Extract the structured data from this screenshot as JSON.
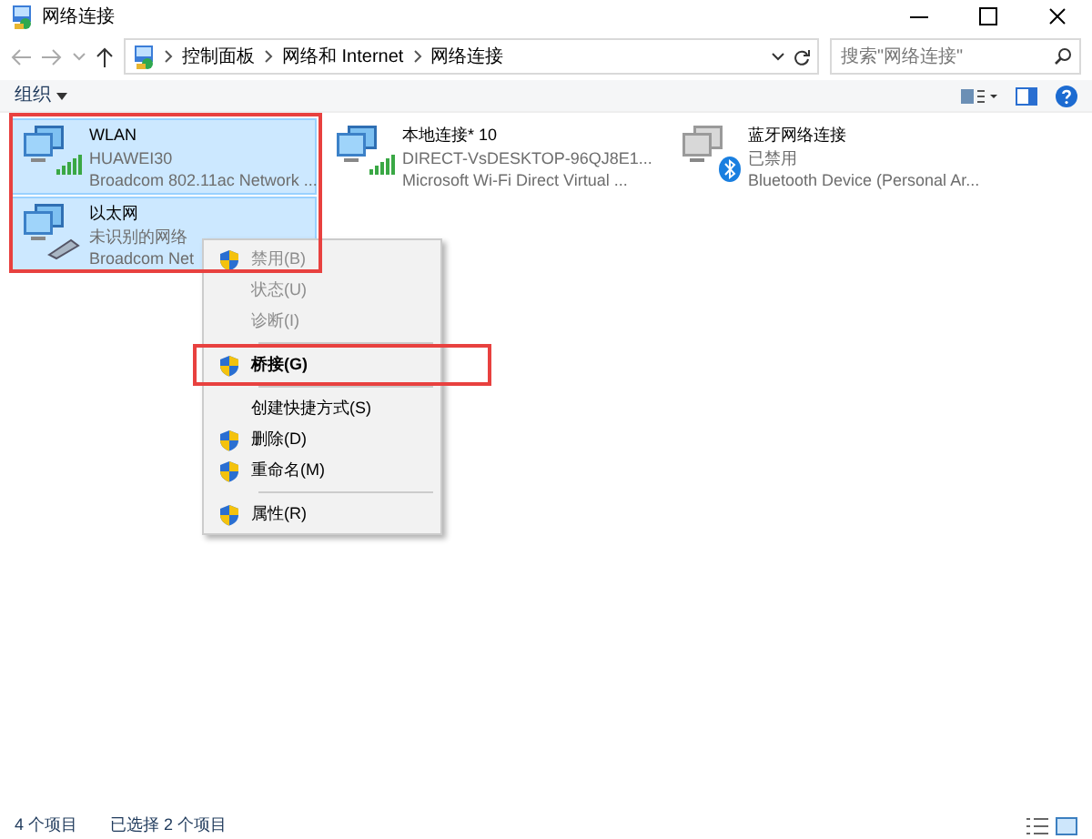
{
  "window": {
    "title": "网络连接"
  },
  "address_bar": {
    "path": [
      "控制面板",
      "网络和 Internet",
      "网络连接"
    ]
  },
  "search": {
    "placeholder": "搜索\"网络连接\""
  },
  "toolbar": {
    "organize": "组织"
  },
  "connections": [
    {
      "name": "WLAN",
      "status": "HUAWEI30",
      "device": "Broadcom 802.11ac Network ...",
      "kind": "wifi",
      "selected": true
    },
    {
      "name": "本地连接* 10",
      "status": "DIRECT-VsDESKTOP-96QJ8E1...",
      "device": "Microsoft Wi-Fi Direct Virtual ...",
      "kind": "wifi",
      "selected": false
    },
    {
      "name": "蓝牙网络连接",
      "status": "已禁用",
      "device": "Bluetooth Device (Personal Ar...",
      "kind": "bluetooth",
      "selected": false
    },
    {
      "name": "以太网",
      "status": "未识别的网络",
      "device": "Broadcom Net",
      "kind": "ethernet",
      "selected": true
    }
  ],
  "context_menu": [
    {
      "label": "禁用(B)",
      "shield": true,
      "disabled": true,
      "bold": false,
      "separator_after": false,
      "marked": false
    },
    {
      "label": "状态(U)",
      "shield": false,
      "disabled": true,
      "bold": false,
      "separator_after": false,
      "marked": false
    },
    {
      "label": "诊断(I)",
      "shield": false,
      "disabled": true,
      "bold": false,
      "separator_after": true,
      "marked": false
    },
    {
      "label": "桥接(G)",
      "shield": true,
      "disabled": false,
      "bold": true,
      "separator_after": true,
      "marked": true
    },
    {
      "label": "创建快捷方式(S)",
      "shield": false,
      "disabled": false,
      "bold": false,
      "separator_after": false,
      "marked": false
    },
    {
      "label": "删除(D)",
      "shield": true,
      "disabled": false,
      "bold": false,
      "separator_after": false,
      "marked": false
    },
    {
      "label": "重命名(M)",
      "shield": true,
      "disabled": false,
      "bold": false,
      "separator_after": true,
      "marked": false
    },
    {
      "label": "属性(R)",
      "shield": true,
      "disabled": false,
      "bold": false,
      "separator_after": false,
      "marked": false
    }
  ],
  "selection_marked": true,
  "status_bar": {
    "count": "4 个项目",
    "selected": "已选择 2 个项目"
  }
}
